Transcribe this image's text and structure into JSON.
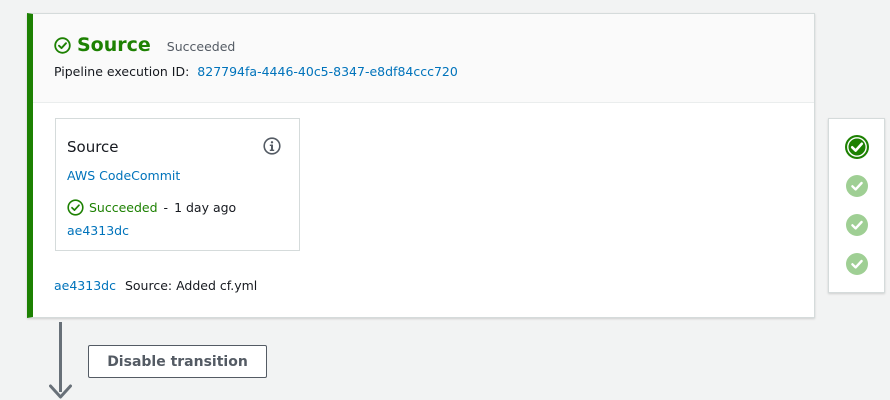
{
  "stage": {
    "title": "Source",
    "status": "Succeeded",
    "execution_label": "Pipeline execution ID:",
    "execution_id": "827794fa-4446-40c5-8347-e8df84ccc720",
    "accent_color": "#1d8102"
  },
  "action": {
    "name": "Source",
    "provider": "AWS CodeCommit",
    "status": "Succeeded",
    "separator": "-",
    "time_ago": "1 day ago",
    "commit_id": "ae4313dc",
    "info_icon": "info-icon"
  },
  "commit": {
    "id": "ae4313dc",
    "message": "Source: Added cf.yml"
  },
  "side_panel": {
    "items": [
      {
        "icon": "check-circle-icon",
        "state": "current",
        "color": "#1d8102"
      },
      {
        "icon": "check-circle-icon",
        "state": "succeeded",
        "color": "#9fcf94"
      },
      {
        "icon": "check-circle-icon",
        "state": "succeeded",
        "color": "#9fcf94"
      },
      {
        "icon": "check-circle-icon",
        "state": "succeeded",
        "color": "#9fcf94"
      }
    ]
  },
  "transition": {
    "button_label": "Disable transition"
  }
}
